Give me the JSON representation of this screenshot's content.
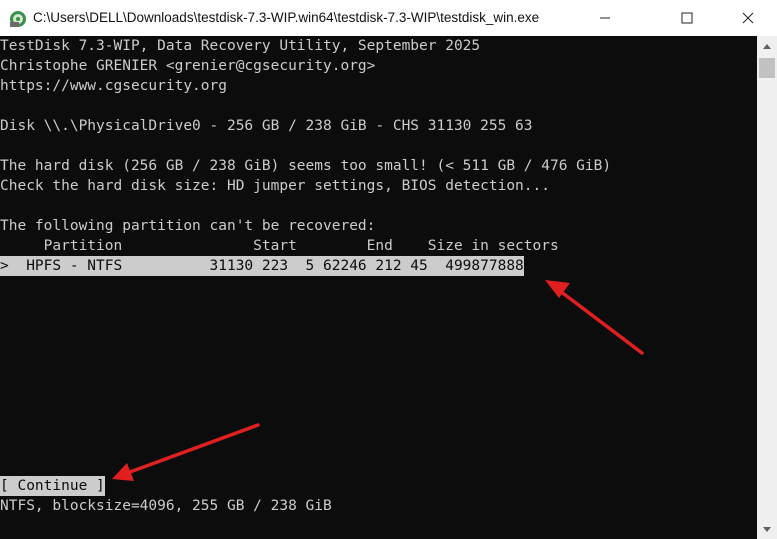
{
  "window": {
    "title": "C:\\Users\\DELL\\Downloads\\testdisk-7.3-WIP.win64\\testdisk-7.3-WIP\\testdisk_win.exe",
    "icon": "testdisk-app-icon",
    "controls": {
      "minimize_icon": "minimize-icon",
      "maximize_icon": "maximize-icon",
      "close_icon": "close-icon"
    }
  },
  "terminal": {
    "header": {
      "line1": "TestDisk 7.3-WIP, Data Recovery Utility, September 2025",
      "line2": "Christophe GRENIER <grenier@cgsecurity.org>",
      "line3": "https://www.cgsecurity.org"
    },
    "disk_info": "Disk \\\\.\\PhysicalDrive0 - 256 GB / 238 GiB - CHS 31130 255 63",
    "warning": {
      "line1": "The hard disk (256 GB / 238 GiB) seems too small! (< 511 GB / 476 GiB)",
      "line2": "Check the hard disk size: HD jumper settings, BIOS detection..."
    },
    "cannot_recover": "The following partition can't be recovered:",
    "table_header": "     Partition               Start        End    Size in sectors",
    "partition_row": ">  HPFS - NTFS          31130 223  5 62246 212 45  499877888",
    "continue_button": "[ Continue ]",
    "status_line": "NTFS, blocksize=4096, 255 GB / 238 GiB"
  },
  "annotation_color": "#e02020"
}
